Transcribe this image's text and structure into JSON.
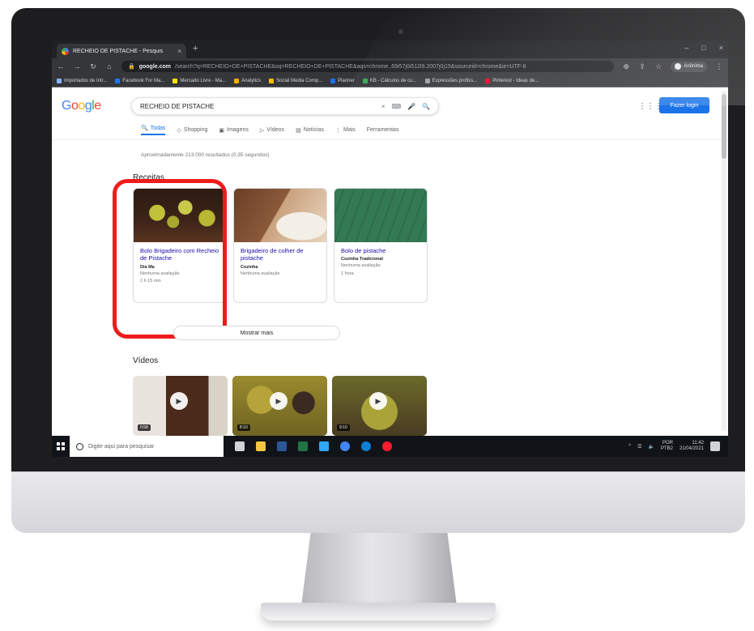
{
  "browser": {
    "tab_title": "RECHEIO DE PISTACHE - Pesquis",
    "tab_close": "×",
    "new_tab": "+",
    "window_controls": [
      "–",
      "□",
      "×"
    ],
    "url_domain": "google.com",
    "url_path": "/search?q=RECHEIO+DE+PISTACHE&oq=RECHEIO+DE+PISTACHE&aqs=chrome..69i57j0i512l9.2007j0j15&sourceid=chrome&ie=UTF-8",
    "profile_label": "Anônima",
    "bookmarks": [
      {
        "label": "Importados de Intr...",
        "color": "#8ab4f8"
      },
      {
        "label": "Facebook For Ma...",
        "color": "#1877f2"
      },
      {
        "label": "Mercado Livre - Ma...",
        "color": "#ffe600"
      },
      {
        "label": "Analytics",
        "color": "#f9ab00"
      },
      {
        "label": "Social Media Comp...",
        "color": "#fbbc04"
      },
      {
        "label": "Planner",
        "color": "#1a73e8"
      },
      {
        "label": "KB - Cálculos de cu...",
        "color": "#34a853"
      },
      {
        "label": "Expressões profiss...",
        "color": "#9aa0a6"
      },
      {
        "label": "Pinterest - Ideas de...",
        "color": "#e60023"
      }
    ]
  },
  "google": {
    "logo_letters": [
      "G",
      "o",
      "o",
      "g",
      "l",
      "e"
    ],
    "query": "RECHEIO DE PISTACHE",
    "clear": "×",
    "sign_in": "Fazer login",
    "tabs": [
      {
        "label": "Todas",
        "icon": "🔍",
        "active": true
      },
      {
        "label": "Shopping",
        "icon": "◇",
        "active": false
      },
      {
        "label": "Imagens",
        "icon": "▣",
        "active": false
      },
      {
        "label": "Vídeos",
        "icon": "▷",
        "active": false
      },
      {
        "label": "Notícias",
        "icon": "▤",
        "active": false
      },
      {
        "label": "Mais",
        "icon": "⋮",
        "active": false
      },
      {
        "label": "Ferramentas",
        "icon": "",
        "active": false
      }
    ],
    "result_stats": "Aproximadamente 213.000 resultados (0,35 segundos)",
    "recipes_heading": "Receitas",
    "recipes": [
      {
        "title": "Bolo Brigadeiro com Recheio de Pistache",
        "source": "Dia Ma",
        "rating": "Nenhuma avaliação",
        "time": "2 h 15 min"
      },
      {
        "title": "Brigadeiro de colher de pistache",
        "source": "Cozinha",
        "rating": "Nenhuma avaliação",
        "time": ""
      },
      {
        "title": "Bolo de pistache",
        "source": "Cozinha Tradicional",
        "rating": "Nenhuma avaliação",
        "time": "1 hora"
      }
    ],
    "show_more": "Mostrar mais",
    "videos_heading": "Vídeos",
    "videos": [
      {
        "duration": "0:58"
      },
      {
        "duration": "8:10"
      },
      {
        "duration": "9:10"
      }
    ]
  },
  "taskbar": {
    "search_placeholder": "Digite aqui para pesquisar",
    "apps": [
      {
        "name": "task-view",
        "color": "#d0d3d7"
      },
      {
        "name": "file-explorer",
        "color": "#f5c542"
      },
      {
        "name": "word",
        "color": "#2b579a"
      },
      {
        "name": "excel",
        "color": "#217346"
      },
      {
        "name": "photoshop",
        "color": "#31a8ff"
      },
      {
        "name": "chrome",
        "color": "#4285f4"
      },
      {
        "name": "edge",
        "color": "#0f7fd4"
      },
      {
        "name": "opera",
        "color": "#ff1b2d"
      }
    ],
    "lang": "POR",
    "lang_sub": "PTB2",
    "time": "11:42",
    "date": "21/04/2021"
  },
  "colors": {
    "highlight": "#ee1c1c",
    "link": "#1a0dab",
    "accent": "#1a73e8"
  }
}
